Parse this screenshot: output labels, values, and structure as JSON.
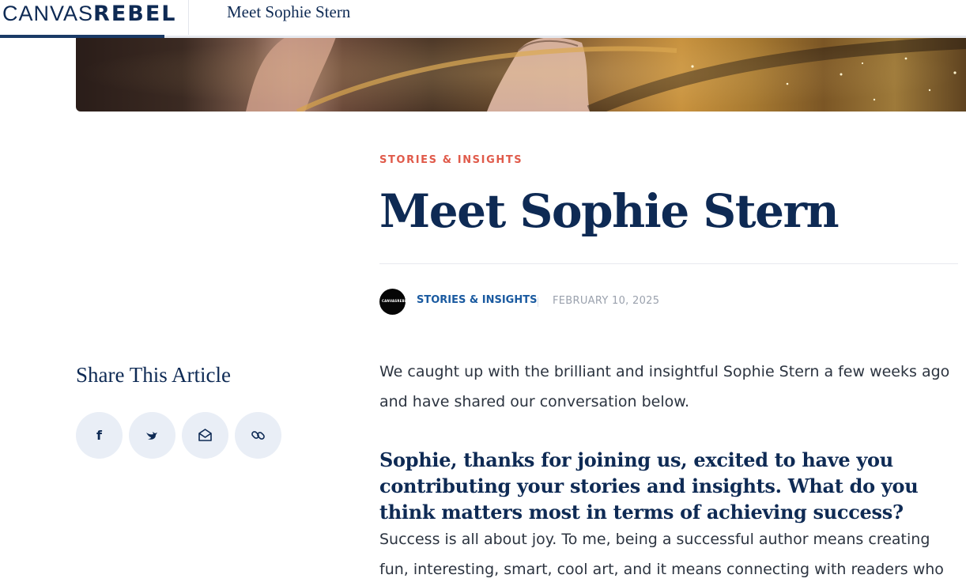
{
  "header": {
    "logo_light": "CANVAS",
    "logo_bold": "REBEL",
    "page_title": "Meet Sophie Stern"
  },
  "article": {
    "category": "STORIES & INSIGHTS",
    "title": "Meet Sophie Stern",
    "author": "STORIES & INSIGHTS",
    "date": "FEBRUARY 10, 2025",
    "avatar_text": "CANVASREBEL",
    "intro": "We caught up with the brilliant and insightful Sophie Stern a few weeks ago and have shared our conversation below.",
    "question": "Sophie, thanks for joining us, excited to have you contributing your stories and insights. What do you think matters most in terms of achieving success?",
    "answer": "Success is all about joy. To me, being a successful author means creating fun, interesting, smart, cool art, and it means connecting with readers who"
  },
  "share": {
    "title": "Share This Article",
    "buttons": [
      {
        "name": "facebook",
        "icon": "facebook-icon",
        "glyph": "f"
      },
      {
        "name": "twitter",
        "icon": "twitter-icon"
      },
      {
        "name": "email",
        "icon": "email-icon"
      },
      {
        "name": "copy-link",
        "icon": "link-icon"
      }
    ]
  },
  "colors": {
    "navy": "#0e2a54",
    "kicker_red": "#e05a4a",
    "author_blue": "#1a5aa0",
    "share_bg": "#e9eef6",
    "date_gray": "#9aa1ad"
  }
}
